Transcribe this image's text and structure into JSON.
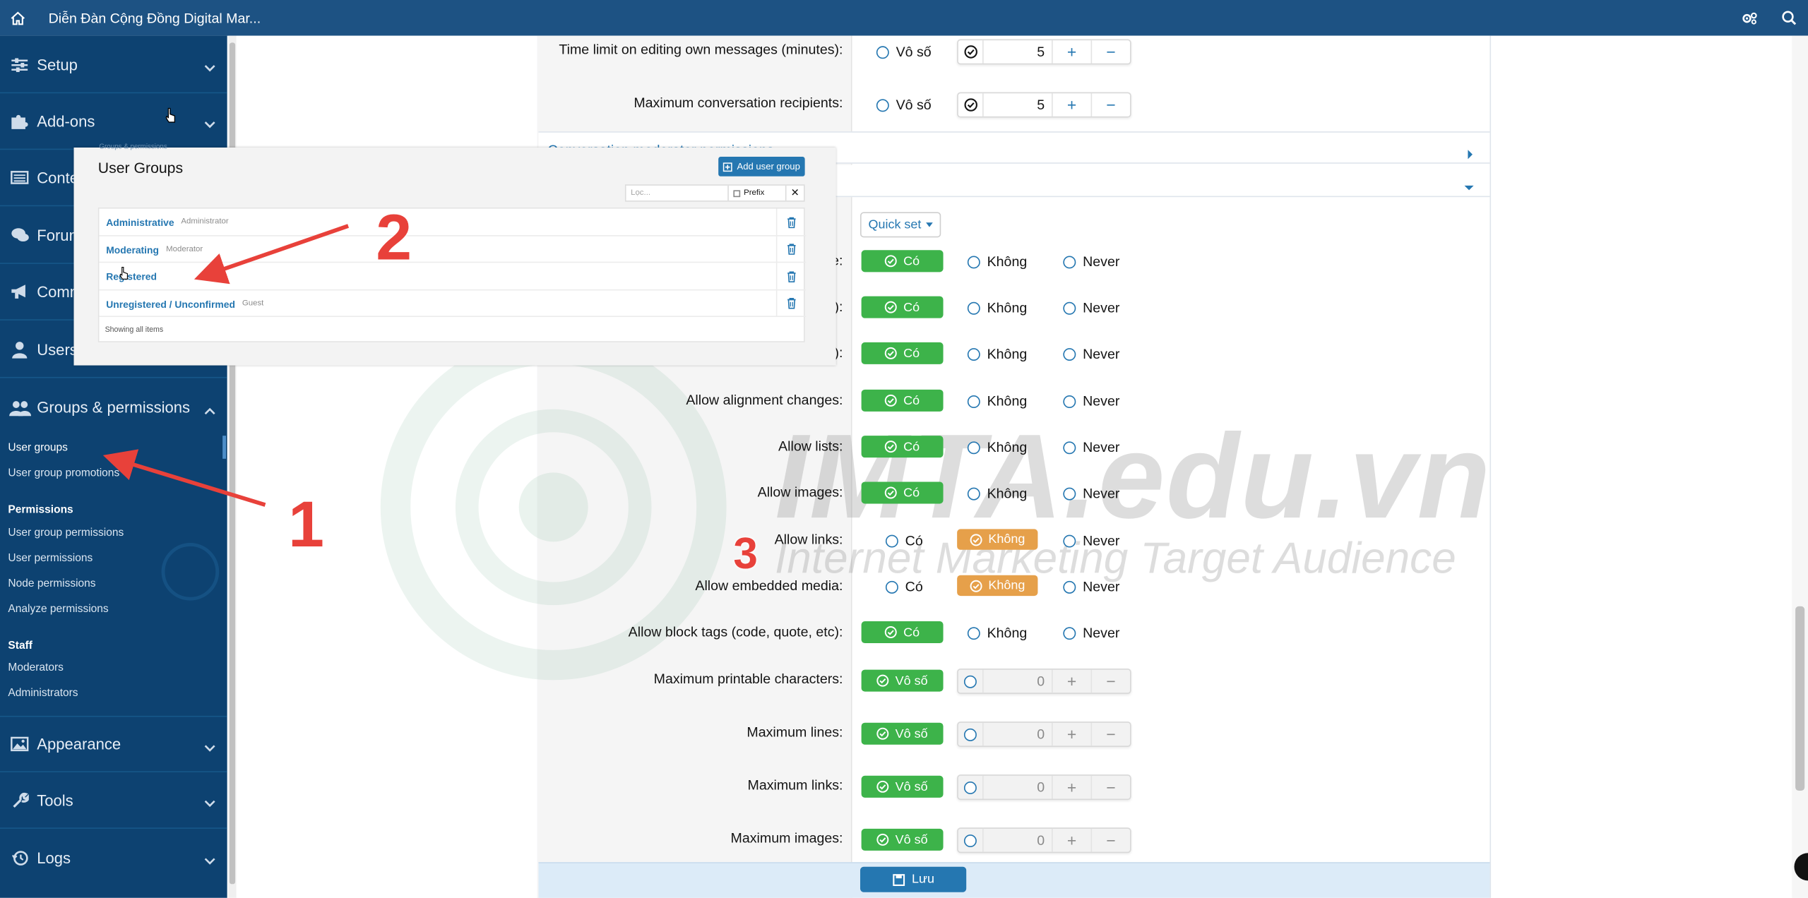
{
  "topbar": {
    "title": "Diễn Đàn Cộng Đồng Digital Mar..."
  },
  "sidebar": {
    "sections": [
      {
        "label": "Setup",
        "icon": "sliders-icon"
      },
      {
        "label": "Add-ons",
        "icon": "puzzle-icon"
      },
      {
        "label": "Content",
        "icon": "newspaper-icon"
      },
      {
        "label": "Forums",
        "icon": "comments-icon"
      },
      {
        "label": "Communication",
        "icon": "bullhorn-icon"
      },
      {
        "label": "Users",
        "icon": "user-icon"
      },
      {
        "label": "Groups & permissions",
        "icon": "users-icon"
      },
      {
        "label": "Appearance",
        "icon": "image-icon"
      },
      {
        "label": "Tools",
        "icon": "wrench-icon"
      },
      {
        "label": "Logs",
        "icon": "history-icon"
      }
    ],
    "groups_items": {
      "user_groups": "User groups",
      "user_group_promotions": "User group promotions",
      "permissions_head": "Permissions",
      "user_group_permissions": "User group permissions",
      "user_permissions": "User permissions",
      "node_permissions": "Node permissions",
      "analyze_permissions": "Analyze permissions",
      "staff_head": "Staff",
      "moderators": "Moderators",
      "administrators": "Administrators"
    }
  },
  "form": {
    "time_limit_label": "Time limit on editing own messages (minutes):",
    "max_recipients_label": "Maximum conversation recipients:",
    "unlimited": "Vô số",
    "stepper_value_5": "5",
    "stepper_value_0": "0",
    "collapsed_section": "Conversation moderator permissions",
    "quick_set": "Quick set",
    "yes": "Có",
    "no": "Không",
    "never": "Never",
    "partial_label_1": "e:",
    "partial_label_2": "):",
    "partial_label_3": "):",
    "allow_alignment": "Allow alignment changes:",
    "allow_lists": "Allow lists:",
    "allow_images": "Allow images:",
    "allow_links": "Allow links:",
    "allow_embedded": "Allow embedded media:",
    "allow_block_tags": "Allow block tags (code, quote, etc):",
    "max_printable": "Maximum printable characters:",
    "max_lines": "Maximum lines:",
    "max_links": "Maximum links:",
    "max_images": "Maximum images:",
    "save": "Lưu"
  },
  "overlay": {
    "title": "User Groups",
    "add_button": "Add user group",
    "filter_placeholder": "Lọc...",
    "prefix": "Prefix",
    "ghost_text": "Groups & permissions",
    "rows": [
      {
        "name": "Administrative",
        "sub": "Administrator"
      },
      {
        "name": "Moderating",
        "sub": "Moderator"
      },
      {
        "name": "Registered",
        "sub": ""
      },
      {
        "name": "Unregistered / Unconfirmed",
        "sub": "Guest"
      }
    ],
    "footer": "Showing all items"
  },
  "annotations": {
    "one": "1",
    "two": "2",
    "three": "3",
    "color": "#e8413a"
  },
  "watermark": {
    "main": "IMTA.edu.vn",
    "sub": "Internet Marketing Target Audience"
  },
  "colors": {
    "topbar": "#1d5283",
    "sidebar": "#0d4271",
    "accent": "#2577b1",
    "green": "#3db34a",
    "orange": "#e6a04a"
  }
}
